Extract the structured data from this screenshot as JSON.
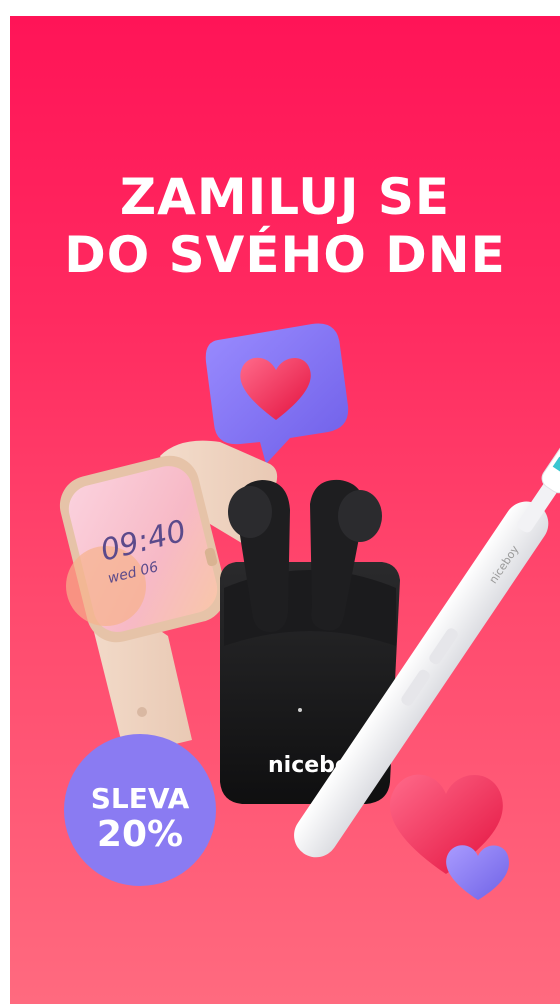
{
  "banner": {
    "headline_line1": "ZAMILUJ SE",
    "headline_line2": "DO SVÉHO DNE",
    "badge_line1": "SLEVA",
    "badge_line2": "20%"
  },
  "products": {
    "watch_time": "09:40",
    "watch_date": "wed 06",
    "earbuds_brand": "niceboy",
    "toothbrush_brand": "niceboy"
  },
  "colors": {
    "background_top": "#ff1457",
    "background_bottom": "#ff6a7f",
    "badge": "#8a7bf2",
    "text": "#ffffff"
  },
  "icons": [
    "heart-speech-bubble-icon",
    "hearts-icon"
  ]
}
